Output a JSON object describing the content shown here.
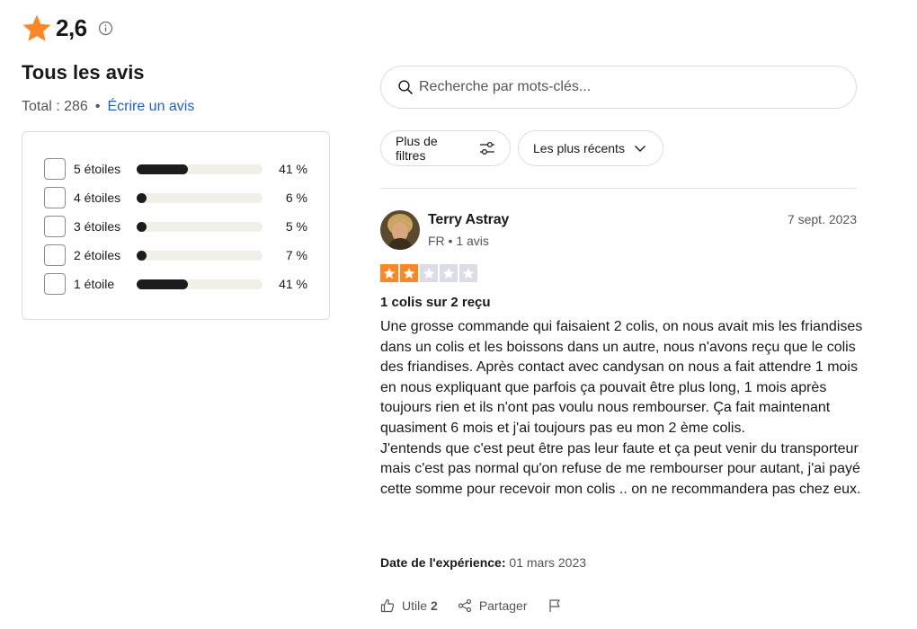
{
  "rating": {
    "value": "2,6",
    "accent": "#ff8622"
  },
  "summary": {
    "title": "Tous les avis",
    "total_label": "Total : 286",
    "separator": "•",
    "write_review": "Écrire un avis"
  },
  "distribution": [
    {
      "label": "5 étoiles",
      "percent_text": "41 %",
      "fraction": 0.41
    },
    {
      "label": "4 étoiles",
      "percent_text": "6 %",
      "fraction": 0.06
    },
    {
      "label": "3 étoiles",
      "percent_text": "5 %",
      "fraction": 0.05
    },
    {
      "label": "2 étoiles",
      "percent_text": "7 %",
      "fraction": 0.07
    },
    {
      "label": "1 étoile",
      "percent_text": "41 %",
      "fraction": 0.41
    }
  ],
  "search": {
    "placeholder": "Recherche par mots-clés..."
  },
  "filters": {
    "more_filters": "Plus de filtres",
    "sort": "Les plus récents"
  },
  "review": {
    "name": "Terry Astray",
    "meta": "FR • 1 avis",
    "date": "7 sept. 2023",
    "stars": 2,
    "star_color": "#ff8622",
    "title": "1 colis sur 2 reçu",
    "body": "Une grosse commande qui faisaient 2 colis, on nous avait mis les friandises dans un colis et les boissons dans un autre, nous n'avons reçu que le colis des friandises. Après contact avec candysan on nous a fait attendre 1 mois en nous expliquant que parfois ça pouvait être plus long, 1 mois après toujours rien et ils n'ont pas voulu nous rembourser. Ça fait maintenant quasiment 6 mois et j'ai toujours pas eu mon 2 ème colis.\nJ'entends que c'est peut être pas leur faute et ça peut venir du transporteur mais c'est pas normal qu'on refuse de me rembourser pour autant, j'ai payé cette somme pour recevoir mon colis .. on ne recommandera pas chez eux.",
    "experience_label": "Date de l'expérience:",
    "experience_date": "01 mars 2023",
    "useful_label": "Utile",
    "useful_count": "2",
    "share_label": "Partager"
  }
}
